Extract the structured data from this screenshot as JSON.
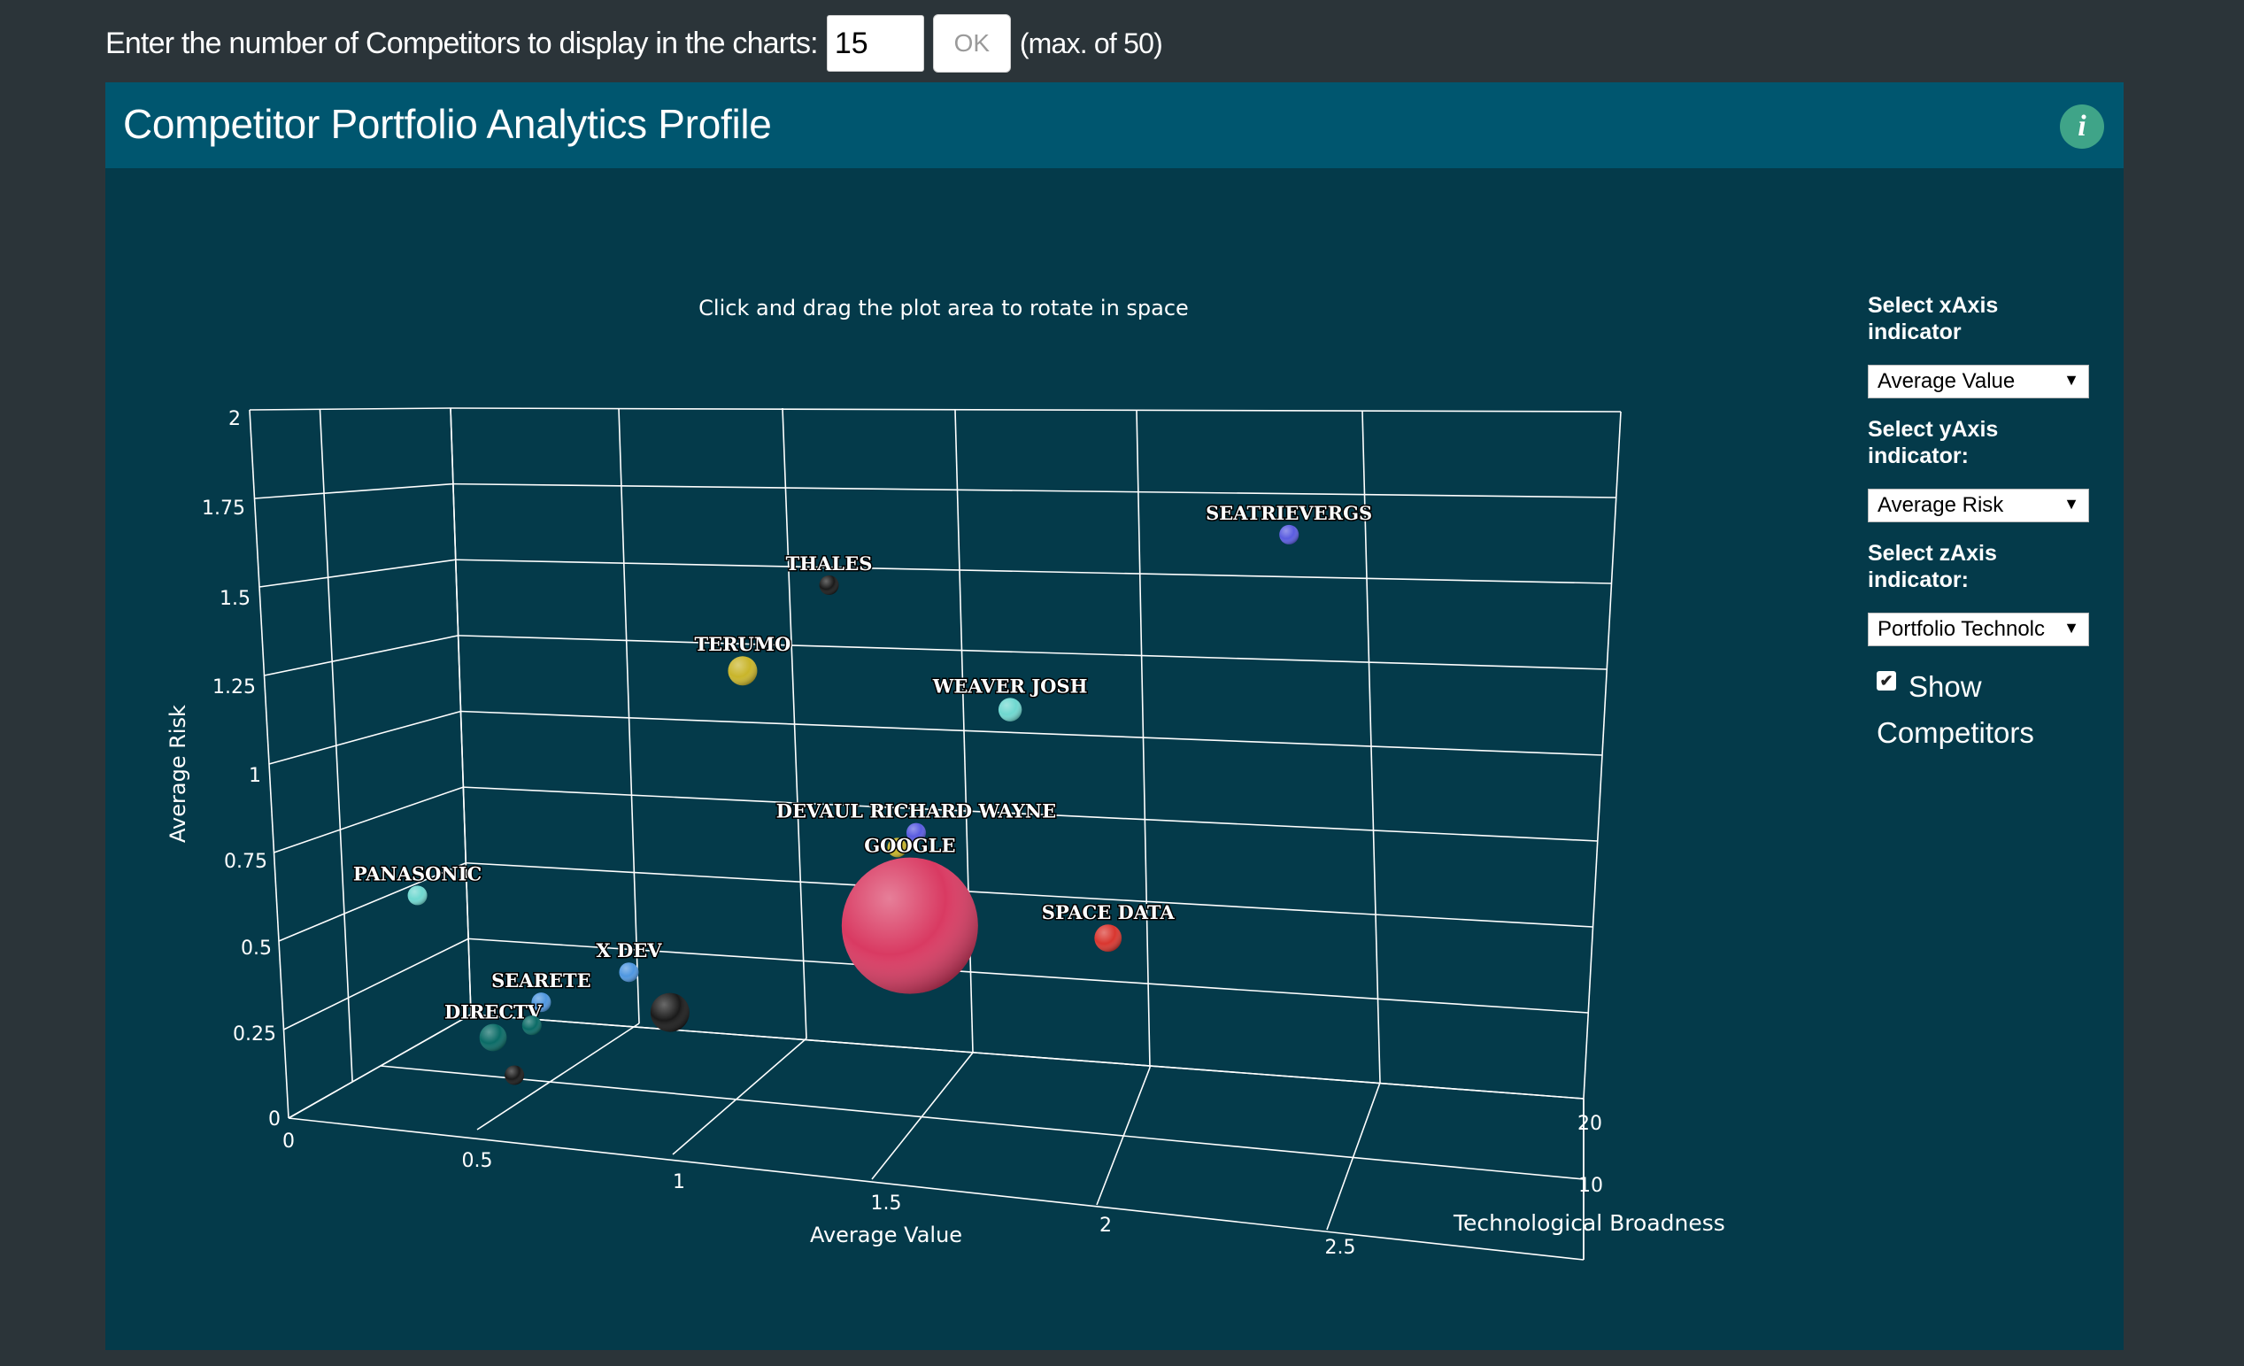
{
  "top_controls": {
    "prompt": "Enter the number of Competitors to display in the charts:",
    "count_value": "15",
    "ok_label": "OK",
    "max_note": "(max. of 50)"
  },
  "panel": {
    "title": "Competitor Portfolio Analytics Profile",
    "info_icon": "info-icon",
    "info_glyph": "i"
  },
  "chart_hint": "Click and drag the plot area to rotate in space",
  "chart_data": {
    "type": "scatter",
    "projection": "3d",
    "xlabel": "Average Value",
    "ylabel": "Average Risk",
    "zlabel": "Technological Broadness",
    "x_ticks": [
      "0",
      "0.5",
      "1",
      "1.5",
      "2",
      "2.5"
    ],
    "y_ticks": [
      "0",
      "0.25",
      "0.5",
      "0.75",
      "1",
      "1.25",
      "1.5",
      "1.75",
      "2"
    ],
    "z_ticks": [
      "20",
      "10"
    ],
    "xlim": [
      0,
      2.8
    ],
    "ylim": [
      0,
      2
    ],
    "zlim": [
      0,
      20
    ],
    "grid": true,
    "points": [
      {
        "name": "SEATRIEVERGS",
        "x": 2.4,
        "y": 1.9,
        "z": 8,
        "size": 1,
        "color": "#5a5ce0"
      },
      {
        "name": "THALES",
        "x": 1.25,
        "y": 1.6,
        "z": 7,
        "size": 1,
        "color": "#1a1a1a"
      },
      {
        "name": "TERUMO",
        "x": 1.1,
        "y": 1.38,
        "z": 4,
        "size": 1.5,
        "color": "#c9b52a"
      },
      {
        "name": "WEAVER JOSH",
        "x": 1.75,
        "y": 1.35,
        "z": 5,
        "size": 1.2,
        "color": "#6fd8d0"
      },
      {
        "name": "DEVAUL RICHARD WAYNE",
        "x": 1.55,
        "y": 1.0,
        "z": 3,
        "size": 1,
        "color": "#5a5ce0"
      },
      {
        "name": "",
        "x": 1.5,
        "y": 0.95,
        "z": 3,
        "size": 1,
        "color": "#c9b52a"
      },
      {
        "name": "GOOGLE",
        "x": 1.55,
        "y": 0.75,
        "z": 2,
        "size": 7,
        "color": "#d93a62"
      },
      {
        "name": "SPACE DATA",
        "x": 2.0,
        "y": 0.75,
        "z": 4,
        "size": 1.4,
        "color": "#d9362f"
      },
      {
        "name": "PANASONIC",
        "x": 0.3,
        "y": 0.65,
        "z": 2,
        "size": 1,
        "color": "#6fd8d0"
      },
      {
        "name": "X DEV",
        "x": 0.75,
        "y": 0.45,
        "z": 5,
        "size": 1,
        "color": "#4f97e0"
      },
      {
        "name": "",
        "x": 0.85,
        "y": 0.35,
        "z": 5,
        "size": 2,
        "color": "#1a1a1a"
      },
      {
        "name": "SEARETE",
        "x": 0.55,
        "y": 0.35,
        "z": 4,
        "size": 1,
        "color": "#4f97e0"
      },
      {
        "name": "DIRECTV",
        "x": 0.45,
        "y": 0.25,
        "z": 3,
        "size": 1.4,
        "color": "#0a6b66"
      },
      {
        "name": "",
        "x": 0.55,
        "y": 0.3,
        "z": 3,
        "size": 1,
        "color": "#0a6b66"
      },
      {
        "name": "",
        "x": 0.5,
        "y": 0.15,
        "z": 3,
        "size": 1,
        "color": "#1a1a1a"
      }
    ]
  },
  "side_controls": {
    "x_label": [
      "Select xAxis",
      "indicator"
    ],
    "x_value": "Average Value",
    "y_label": [
      "Select yAxis",
      "indicator:"
    ],
    "y_value": "Average Risk",
    "z_label": [
      "Select zAxis",
      "indicator:"
    ],
    "z_value": "Portfolio Technolc",
    "show_label": "Show",
    "competitors_label": "Competitors",
    "show_checked": true
  },
  "colors": {
    "page_bg": "#2b3439",
    "panel_bg": "#043a4a",
    "header_bg": "#00566f",
    "info_green": "#3fa488"
  }
}
